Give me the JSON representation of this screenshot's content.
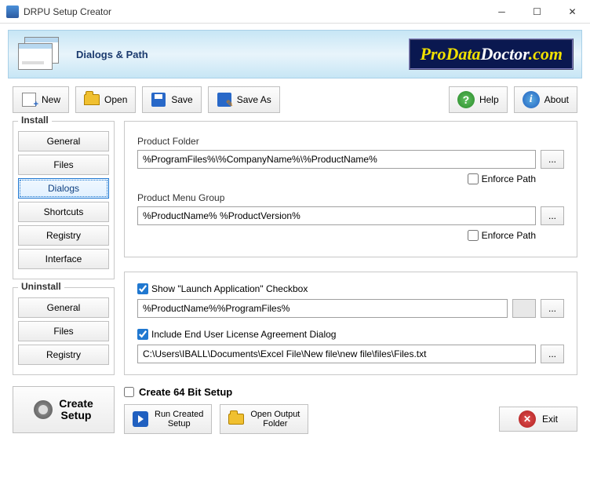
{
  "window": {
    "title": "DRPU Setup Creator"
  },
  "banner": {
    "title": "Dialogs & Path",
    "logo": {
      "p1": "ProData",
      "p2": "Doctor",
      "p3": ".com"
    }
  },
  "toolbar": {
    "new": "New",
    "open": "Open",
    "save": "Save",
    "saveas": "Save As",
    "help": "Help",
    "about": "About"
  },
  "sidebar": {
    "install": {
      "title": "Install",
      "items": [
        "General",
        "Files",
        "Dialogs",
        "Shortcuts",
        "Registry",
        "Interface"
      ],
      "selected": "Dialogs"
    },
    "uninstall": {
      "title": "Uninstall",
      "items": [
        "General",
        "Files",
        "Registry"
      ]
    }
  },
  "panels": {
    "folder": {
      "label": "Product Folder",
      "value": "%ProgramFiles%\\%CompanyName%\\%ProductName%",
      "enforce_label": "Enforce Path",
      "enforce_checked": false
    },
    "menu": {
      "label": "Product Menu Group",
      "value": "%ProductName% %ProductVersion%",
      "enforce_label": "Enforce Path",
      "enforce_checked": false
    },
    "launch": {
      "cb_label": "Show \"Launch Application\" Checkbox",
      "checked": true,
      "value": "%ProductName%%ProgramFiles%"
    },
    "eula": {
      "cb_label": "Include End User License Agreement Dialog",
      "checked": true,
      "value": "C:\\Users\\IBALL\\Documents\\Excel File\\New file\\new file\\files\\Files.txt"
    },
    "browse": "..."
  },
  "footer": {
    "create": "Create\nSetup",
    "bit64": "Create 64 Bit Setup",
    "bit64_checked": false,
    "run": "Run Created\nSetup",
    "output": "Open Output\nFolder",
    "exit": "Exit"
  }
}
